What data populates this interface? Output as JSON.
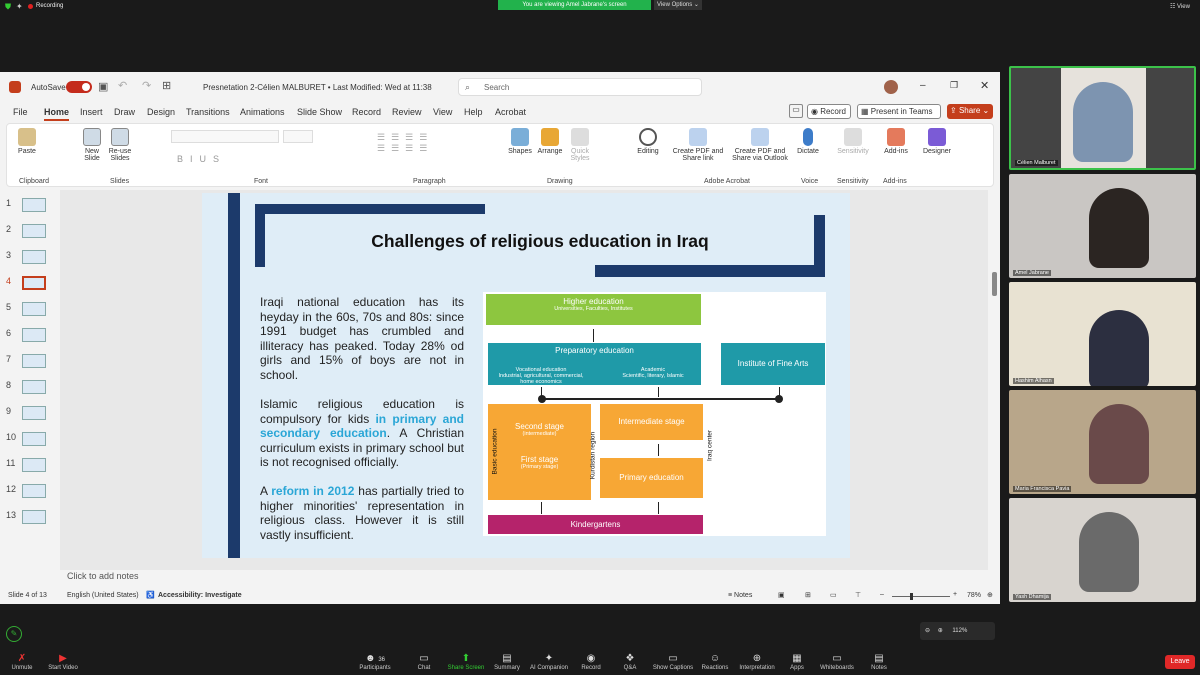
{
  "zoom": {
    "recording": "Recording",
    "viewing_banner": "You are viewing Amel Jabrane's screen",
    "view_options": "View Options",
    "view": "View",
    "participants_count": "36",
    "zoom_level": "112%",
    "toolbar": [
      {
        "label": "Unmute",
        "icon": "mic-off-icon"
      },
      {
        "label": "Start Video",
        "icon": "video-off-icon"
      },
      {
        "label": "Participants",
        "icon": "participants-icon"
      },
      {
        "label": "Chat",
        "icon": "chat-icon"
      },
      {
        "label": "Share Screen",
        "icon": "share-screen-icon"
      },
      {
        "label": "Summary",
        "icon": "summary-icon"
      },
      {
        "label": "AI Companion",
        "icon": "ai-icon"
      },
      {
        "label": "Record",
        "icon": "record-icon"
      },
      {
        "label": "Q&A",
        "icon": "qa-icon"
      },
      {
        "label": "Show Captions",
        "icon": "cc-icon"
      },
      {
        "label": "Reactions",
        "icon": "reactions-icon"
      },
      {
        "label": "Interpretation",
        "icon": "globe-icon"
      },
      {
        "label": "Apps",
        "icon": "apps-icon"
      },
      {
        "label": "Whiteboards",
        "icon": "whiteboard-icon"
      },
      {
        "label": "Notes",
        "icon": "notes-icon"
      }
    ],
    "leave": "Leave",
    "participants": [
      {
        "name": "Célien Malburet"
      },
      {
        "name": "Amel Jabrane"
      },
      {
        "name": "Hashim Alhasn"
      },
      {
        "name": "Maria Francisca Pavia"
      },
      {
        "name": "Yash Dhamija"
      }
    ]
  },
  "ppt": {
    "autosave": "AutoSave",
    "title": "Presnetation 2-Célien MALBURET • Last Modified: Wed at 11:38",
    "search_placeholder": "Search",
    "menus": [
      "File",
      "Home",
      "Insert",
      "Draw",
      "Design",
      "Transitions",
      "Animations",
      "Slide Show",
      "Record",
      "Review",
      "View",
      "Help",
      "Acrobat"
    ],
    "record_btn": "Record",
    "present_btn": "Present in Teams",
    "share_btn": "Share",
    "ribbon": {
      "paste": "Paste",
      "clipboard": "Clipboard",
      "new_slide": "New Slide",
      "reuse": "Re-use Slides",
      "slides": "Slides",
      "font": "Font",
      "paragraph": "Paragraph",
      "shapes": "Shapes",
      "arrange": "Arrange",
      "quick_styles": "Quick Styles",
      "drawing": "Drawing",
      "editing": "Editing",
      "create_pdf": "Create PDF and Share link",
      "create_pdf_outlook": "Create PDF and Share via Outlook",
      "acrobat": "Adobe Acrobat",
      "dictate": "Dictate",
      "voice": "Voice",
      "sensitivity": "Sensitivity",
      "sensitivity_group": "Sensitivity",
      "addins": "Add-ins",
      "addins_group": "Add-ins",
      "designer": "Designer"
    },
    "thumb_numbers": [
      "1",
      "2",
      "3",
      "4",
      "5",
      "6",
      "7",
      "8",
      "9",
      "10",
      "11",
      "12",
      "13"
    ],
    "notes_placeholder": "Click to add notes",
    "status": {
      "slide": "Slide 4 of 13",
      "lang": "English (United States)",
      "accessibility": "Accessibility: Investigate",
      "notes": "Notes",
      "zoom": "78%"
    }
  },
  "slide": {
    "title": "Challenges of religious education in Iraq",
    "p1": "Iraqi national education has its heyday in the 60s, 70s and 80s: since 1991 budget has crumbled and illiteracy has peaked. Today 28% od girls and 15% of boys are not in school.",
    "p2a": "Islamic religious education is compulsory for kids ",
    "p2b": "in primary and secondary education",
    "p2c": ". A Christian curriculum exists in primary school but is not recognised officially.",
    "p3a": "A ",
    "p3b": "reform in 2012",
    "p3c": " has partially tried to higher minorities' representation in religious class. However it is still vastly insufficient.",
    "diagram": {
      "higher": "Higher education",
      "higher_sub": "Universities, Faculties, Institutes",
      "prep": "Preparatory education",
      "voc": "Vocational education",
      "voc_sub": "Industrial, agricultural, commercial, home economics",
      "acad": "Academic",
      "acad_sub": "Scientific, literary, Islamic",
      "fine_arts": "Institute of Fine Arts",
      "second": "Second stage",
      "second_sub": "(intermediate)",
      "first": "First stage",
      "first_sub": "(Primary stage)",
      "basic": "Basic education",
      "kurdistan": "Kurdistan region",
      "intermediate": "Intermediate stage",
      "primary": "Primary education",
      "iraq_center": "Iraq center",
      "kinder": "Kindergartens"
    }
  }
}
